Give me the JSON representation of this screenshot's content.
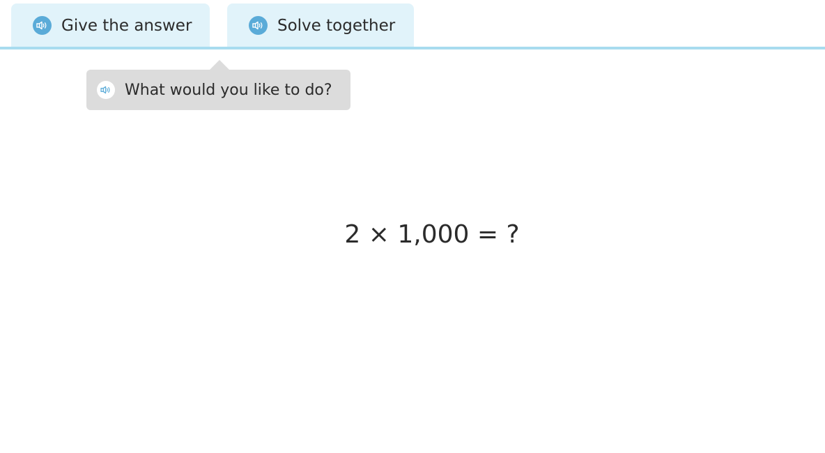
{
  "tabs": [
    {
      "label": "Give the answer",
      "icon": "speaker-icon"
    },
    {
      "label": "Solve together",
      "icon": "speaker-icon"
    }
  ],
  "tooltip": {
    "text": "What would you like to do?",
    "icon": "speaker-icon"
  },
  "problem": {
    "equation": "2 × 1,000 = ?"
  },
  "colors": {
    "tab_background": "#e1f3fa",
    "tab_bar_line": "#a8dcef",
    "speaker_icon": "#5aabd8",
    "tooltip_background": "#dcdcdc"
  }
}
